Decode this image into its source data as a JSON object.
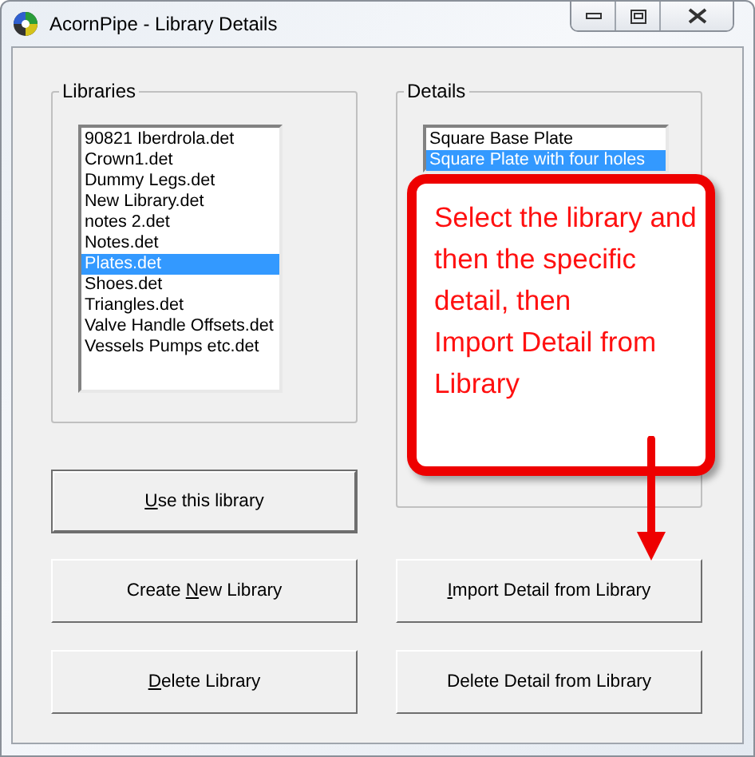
{
  "window": {
    "title": "AcornPipe - Library Details"
  },
  "libraries": {
    "label": "Libraries",
    "items": [
      {
        "text": "90821 Iberdrola.det",
        "selected": false
      },
      {
        "text": "Crown1.det",
        "selected": false
      },
      {
        "text": "Dummy Legs.det",
        "selected": false
      },
      {
        "text": "New Library.det",
        "selected": false
      },
      {
        "text": "notes 2.det",
        "selected": false
      },
      {
        "text": "Notes.det",
        "selected": false
      },
      {
        "text": "Plates.det",
        "selected": true
      },
      {
        "text": "Shoes.det",
        "selected": false
      },
      {
        "text": "Triangles.det",
        "selected": false
      },
      {
        "text": "Valve Handle Offsets.det",
        "selected": false
      },
      {
        "text": "Vessels Pumps etc.det",
        "selected": false
      }
    ]
  },
  "details": {
    "label": "Details",
    "items": [
      {
        "text": "Square Base Plate",
        "selected": false
      },
      {
        "text": "Square Plate with four holes",
        "selected": true
      }
    ]
  },
  "use_button": {
    "key": "U",
    "after": "se this library",
    "default": true
  },
  "buttons": [
    {
      "before": "Create ",
      "key": "N",
      "after": "ew Library"
    },
    {
      "key": "I",
      "after": "mport Detail from Library"
    },
    {
      "key": "D",
      "after": "elete Library"
    },
    {
      "before": "Delete Detail from Library"
    }
  ],
  "callout": {
    "text": "Select the library and then the specific detail, then\nImport Detail from Library"
  }
}
